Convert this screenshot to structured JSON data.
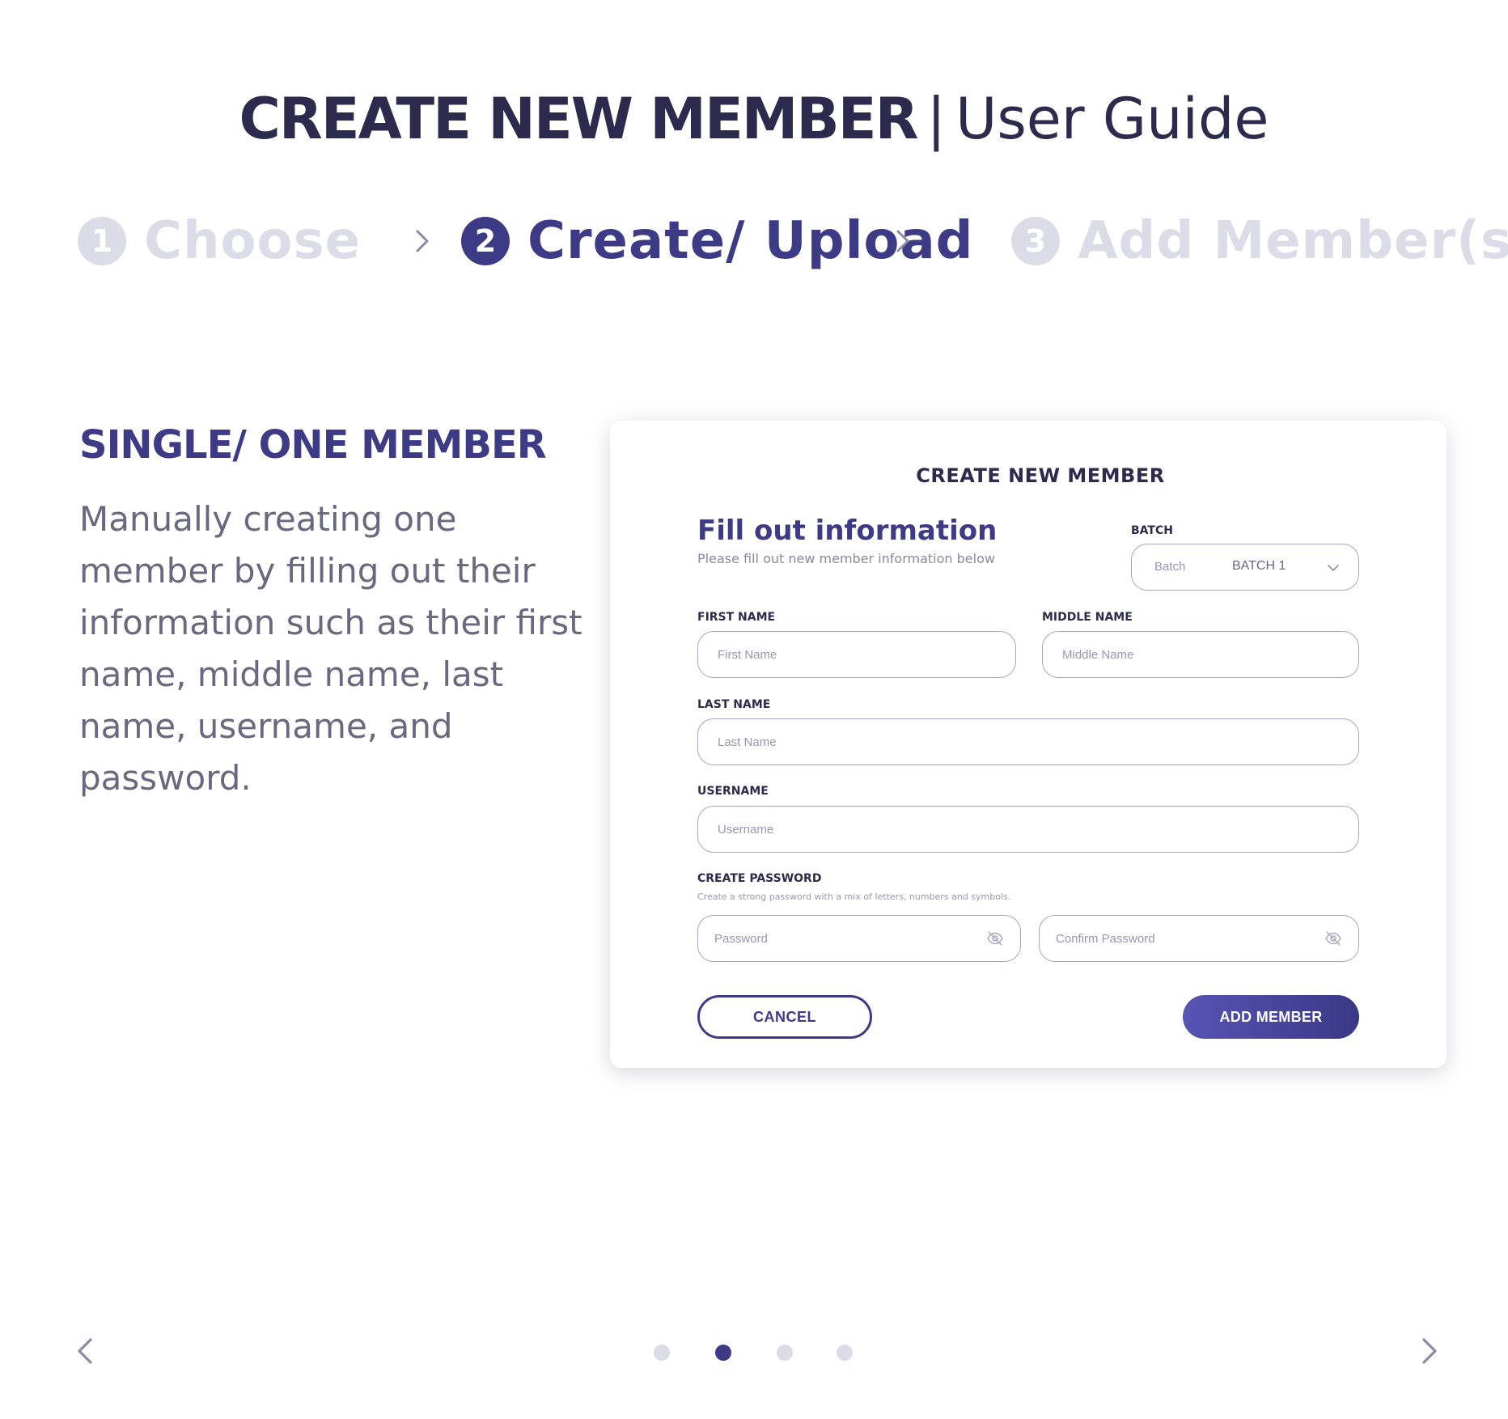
{
  "header": {
    "title_strong": "CREATE NEW MEMBER",
    "title_separator": "|",
    "title_light": "User Guide"
  },
  "steps": [
    {
      "number": "1",
      "label": "Choose",
      "state": "inactive"
    },
    {
      "number": "2",
      "label": "Create/ Upload",
      "state": "active"
    },
    {
      "number": "3",
      "label": "Add Member(s)",
      "state": "inactive"
    }
  ],
  "section": {
    "heading": "SINGLE/ ONE MEMBER",
    "description": "Manually creating one member by filling out their information such as their first name, middle name, last name, username, and password."
  },
  "form": {
    "title": "CREATE  NEW MEMBER",
    "fill_title": "Fill out information",
    "fill_subtitle": "Please fill out new member information below",
    "batch": {
      "label": "BATCH",
      "placeholder": "Batch",
      "value": "BATCH 1"
    },
    "first_name": {
      "label": "FIRST NAME",
      "placeholder": "First Name"
    },
    "middle_name": {
      "label": "MIDDLE NAME",
      "placeholder": "Middle Name"
    },
    "last_name": {
      "label": "LAST NAME",
      "placeholder": "Last Name"
    },
    "username": {
      "label": "USERNAME",
      "placeholder": "Username"
    },
    "password": {
      "label": "CREATE PASSWORD",
      "hint": "Create a strong password with a mix of letters, numbers and symbols.",
      "placeholder": "Password",
      "confirm_placeholder": "Confirm Password"
    },
    "cancel_label": "CANCEL",
    "add_label": "ADD MEMBER"
  },
  "pagination": {
    "total": 4,
    "active_index": 1
  },
  "colors": {
    "primary": "#3d3a86",
    "title": "#2c2b4d",
    "inactive": "#dcdbe8",
    "body_text": "#6a6880"
  },
  "icons": {
    "prev": "chevron-left-icon",
    "next": "chevron-right-icon",
    "step_separator": "chevron-right-icon",
    "dropdown": "chevron-down-icon",
    "password_toggle": "eye-off-icon"
  }
}
